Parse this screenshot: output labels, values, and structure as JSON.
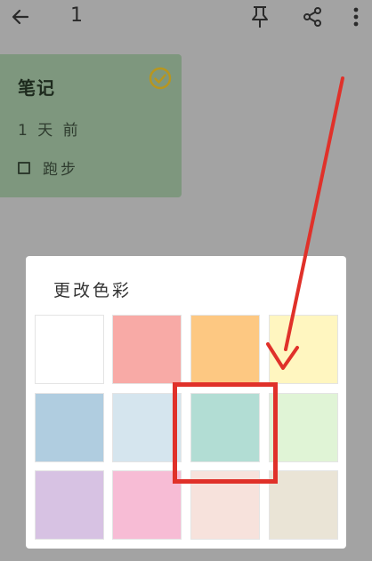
{
  "topbar": {
    "note_count": "1",
    "icons": [
      "back-arrow-icon",
      "pin-icon",
      "share-icon",
      "more-vertical-icon"
    ]
  },
  "note": {
    "title": "笔记",
    "time": "1 天 前",
    "checklist_item": "跑步",
    "status_icon": "check-circle-icon"
  },
  "color_dialog": {
    "title": "更改色彩",
    "swatches": [
      {
        "color": "#ffffff"
      },
      {
        "color": "#f8aaa6"
      },
      {
        "color": "#fdc882"
      },
      {
        "color": "#fff6c0"
      },
      {
        "color": "#b0cde0"
      },
      {
        "color": "#d5e5ee"
      },
      {
        "color": "#b2ddd4"
      },
      {
        "color": "#e0f4d6"
      },
      {
        "color": "#d7c2e3"
      },
      {
        "color": "#f7bcd5"
      },
      {
        "color": "#f7e2dc"
      },
      {
        "color": "#eae4d6"
      }
    ],
    "highlighted_swatch": 6
  },
  "annotation": {
    "arrow_color": "#e0312a"
  }
}
